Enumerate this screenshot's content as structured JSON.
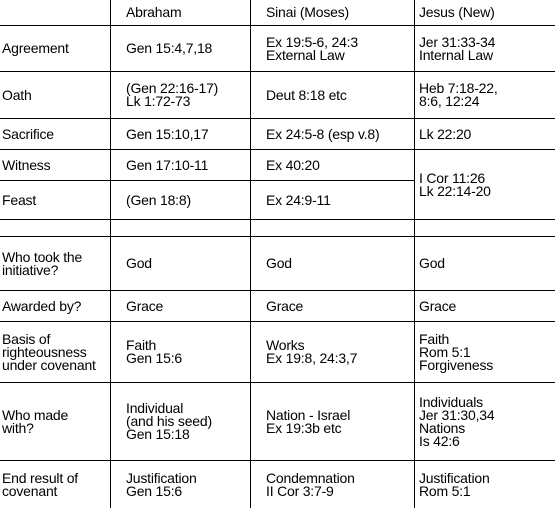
{
  "table": {
    "headers": [
      "",
      "Abraham",
      "Sinai (Moses)",
      "Jesus (New)"
    ],
    "rows": [
      {
        "label": [
          "Agreement"
        ],
        "abraham": [
          "Gen 15:4,7,18"
        ],
        "sinai": [
          "Ex 19:5-6, 24:3",
          "External Law"
        ],
        "jesus": [
          "Jer 31:33-34",
          "Internal Law"
        ]
      },
      {
        "label": [
          "Oath"
        ],
        "abraham": [
          "(Gen 22:16-17)",
          "Lk 1:72-73"
        ],
        "sinai": [
          "Deut 8:18 etc"
        ],
        "jesus": [
          "Heb 7:18-22,",
          "8:6, 12:24"
        ]
      },
      {
        "label": [
          "Sacrifice"
        ],
        "abraham": [
          "Gen 15:10,17"
        ],
        "sinai": [
          "Ex 24:5-8 (esp v.8)"
        ],
        "jesus": [
          "Lk 22:20"
        ]
      },
      {
        "label": [
          "Witness"
        ],
        "abraham": [
          "Gen 17:10-11"
        ],
        "sinai": [
          "Ex 40:20"
        ],
        "jesus": [
          "I Cor 11:26",
          "Lk 22:14-20"
        ]
      },
      {
        "label": [
          "Feast"
        ],
        "abraham": [
          "(Gen 18:8)"
        ],
        "sinai": [
          "Ex 24:9-11"
        ],
        "jesus": null
      },
      {
        "label": [
          ""
        ],
        "abraham": [
          ""
        ],
        "sinai": [
          ""
        ],
        "jesus": [
          ""
        ]
      },
      {
        "label": [
          "Who took the",
          "initiative?"
        ],
        "abraham": [
          "God"
        ],
        "sinai": [
          "God"
        ],
        "jesus": [
          "God"
        ]
      },
      {
        "label": [
          "Awarded by?"
        ],
        "abraham": [
          "Grace"
        ],
        "sinai": [
          "Grace"
        ],
        "jesus": [
          "Grace"
        ]
      },
      {
        "label": [
          "Basis of",
          "righteousness",
          "under covenant"
        ],
        "abraham": [
          "Faith",
          "Gen 15:6"
        ],
        "sinai": [
          "Works",
          "Ex 19:8, 24:3,7"
        ],
        "jesus": [
          "Faith",
          "Rom 5:1",
          "Forgiveness"
        ]
      },
      {
        "label": [
          "Who made",
          "with?"
        ],
        "abraham": [
          "Individual",
          "(and his seed)",
          "Gen 15:18"
        ],
        "sinai": [
          "Nation - Israel",
          "Ex 19:3b etc"
        ],
        "jesus": [
          "Individuals",
          "Jer 31:30,34",
          "Nations",
          "Is 42:6"
        ]
      },
      {
        "label": [
          "End result of",
          "covenant"
        ],
        "abraham": [
          "Justification",
          "Gen 15:6"
        ],
        "sinai": [
          "Condemnation",
          "II Cor 3:7-9"
        ],
        "jesus": [
          "Justification",
          "Rom 5:1"
        ]
      }
    ]
  }
}
